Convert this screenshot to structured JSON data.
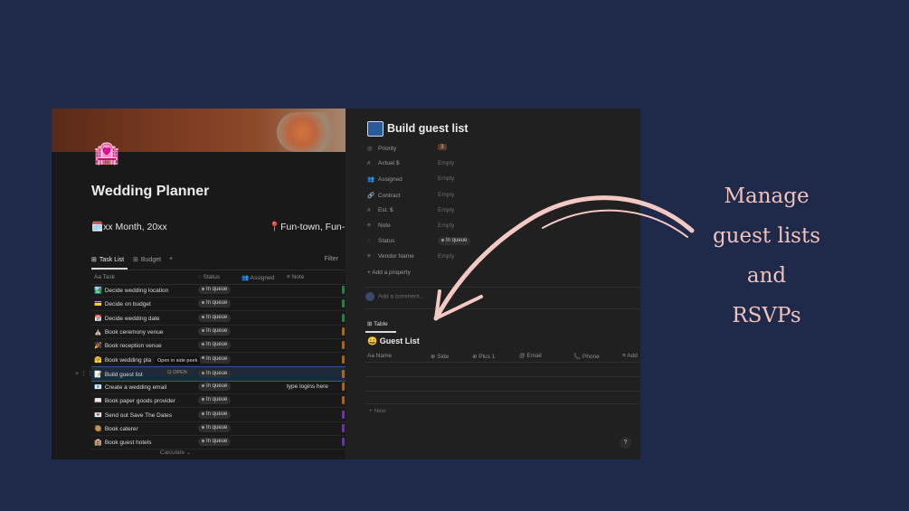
{
  "left": {
    "page_icon": "🏩",
    "title": "Wedding Planner",
    "date": "🗓️xx Month, 20xx",
    "location": "📍Fun-town, Fun-",
    "tabs": [
      {
        "label": "Task List",
        "active": true
      },
      {
        "label": "Budget",
        "active": false
      }
    ],
    "add_view": "+",
    "filter_label": "Filter",
    "columns": [
      "Aa Task",
      "Status",
      "Assigned",
      "Note"
    ],
    "rows": [
      {
        "emoji": "🏞️",
        "task": "Decide wedding location",
        "status": "In queue",
        "note": "",
        "color": "#2e7a4a"
      },
      {
        "emoji": "💳",
        "task": "Decide on budget",
        "status": "In queue",
        "note": "",
        "color": "#2e7a4a"
      },
      {
        "emoji": "📅",
        "task": "Decide wedding date",
        "status": "In queue",
        "note": "",
        "color": "#2e7a4a"
      },
      {
        "emoji": "⛪",
        "task": "Book ceremony venue",
        "status": "In queue",
        "note": "",
        "color": "#a0672a"
      },
      {
        "emoji": "🎉",
        "task": "Book reception venue",
        "status": "In queue",
        "note": "",
        "color": "#a0672a"
      },
      {
        "emoji": "🤗",
        "task": "Book wedding pla",
        "status": "In queue",
        "note": "",
        "color": "#a0672a"
      },
      {
        "emoji": "📝",
        "task": "Build guest list",
        "status": "In queue",
        "note": "",
        "color": "#a0672a"
      },
      {
        "emoji": "📧",
        "task": "Create a wedding email",
        "status": "In queue",
        "note": "type logins here",
        "color": "#a0672a"
      },
      {
        "emoji": "📖",
        "task": "Book paper goods provider",
        "status": "In queue",
        "note": "",
        "color": "#a0672a"
      },
      {
        "emoji": "💌",
        "task": "Send out Save The Dates",
        "status": "In queue",
        "note": "",
        "color": "#6a3a9a"
      },
      {
        "emoji": "🥘",
        "task": "Book caterer",
        "status": "In queue",
        "note": "",
        "color": "#6a3a9a"
      },
      {
        "emoji": "🏨",
        "task": "Book guest hotels",
        "status": "In queue",
        "note": "",
        "color": "#6a3a9a"
      }
    ],
    "tooltip": "Open in side peek",
    "open_label": "OPEN",
    "calculate_label": "Calculate ⌄"
  },
  "right": {
    "title": "Build guest list",
    "properties": [
      {
        "icon": "◎",
        "label": "Priority",
        "value": "3",
        "kind": "priority"
      },
      {
        "icon": "#",
        "label": "Actual $",
        "value": "Empty",
        "kind": "empty"
      },
      {
        "icon": "👥",
        "label": "Assigned",
        "value": "Empty",
        "kind": "empty"
      },
      {
        "icon": "🔗",
        "label": "Contract",
        "value": "Empty",
        "kind": "empty"
      },
      {
        "icon": "#",
        "label": "Est. $",
        "value": "Empty",
        "kind": "empty"
      },
      {
        "icon": "≡",
        "label": "Note",
        "value": "Empty",
        "kind": "empty"
      },
      {
        "icon": "◌",
        "label": "Status",
        "value": "In queue",
        "kind": "status"
      },
      {
        "icon": "≡",
        "label": "Vendor Name",
        "value": "Empty",
        "kind": "empty"
      }
    ],
    "add_property": "+ Add a property",
    "add_comment": "Add a comment...",
    "table_tab": "Table",
    "guest_list_title": "😄 Guest List",
    "guest_columns": [
      "Aa Name",
      "⊕ Side",
      "⊕ Plus 1",
      "@ Email",
      "📞 Phone",
      "≡ Add"
    ],
    "new_label": "+ New",
    "help": "?"
  },
  "caption": [
    "Manage",
    "guest lists",
    "and",
    "RSVPs"
  ],
  "colors": {
    "background": "#1f2a4a",
    "caption": "#f1c2bb",
    "arrow": "#f4c9c3"
  }
}
